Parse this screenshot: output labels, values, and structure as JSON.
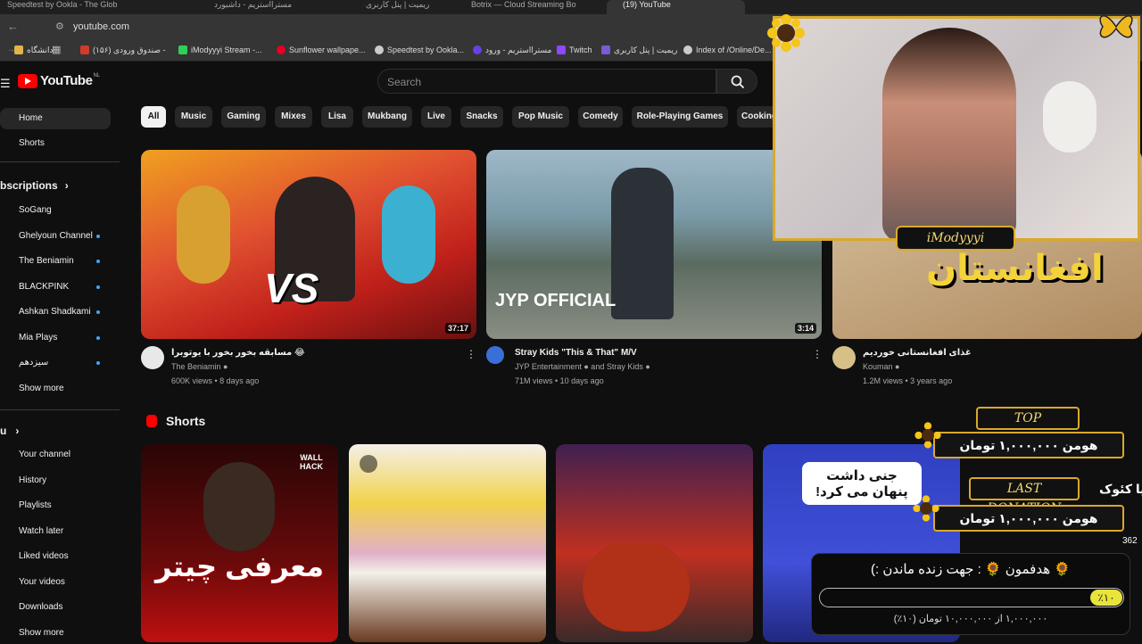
{
  "browser": {
    "tabs": [
      "Speedtest by Ookla - The Glob",
      "مسترااستریم - داشبورد",
      "ریمیت | پنل کاربری",
      "Botrix — Cloud Streaming Bot",
      "(19) YouTube"
    ],
    "url": "youtube.com",
    "bookmarks": [
      {
        "label": "دانشگاه",
        "color": "#e2b44a"
      },
      {
        "label": "صندوق ورودی (۱۵۶) -",
        "color": "#d23b2a"
      },
      {
        "label": "iModyyyi Stream -...",
        "color": "#2fcf57"
      },
      {
        "label": "Sunflower wallpape...",
        "color": "#e60023"
      },
      {
        "label": "Speedtest by Ookla...",
        "color": "#cccccc"
      },
      {
        "label": "مسترااستریم - ورود",
        "color": "#6b3ee6"
      },
      {
        "label": "Twitch",
        "color": "#9146ff"
      },
      {
        "label": "ریمیت | پنل کاربری",
        "color": "#7a5bd6"
      },
      {
        "label": "Index of /Online/De...",
        "color": "#cccccc"
      }
    ]
  },
  "youtube": {
    "logo_text": "YouTube",
    "region": "NL",
    "search_placeholder": "Search",
    "nav": [
      {
        "label": "Home"
      },
      {
        "label": "Shorts"
      }
    ],
    "subscriptions_heading": "bscriptions",
    "subscriptions": [
      {
        "label": "SoGang",
        "dot": false
      },
      {
        "label": "Ghelyoun Channel",
        "dot": true
      },
      {
        "label": "The Beniamin",
        "dot": true
      },
      {
        "label": "BLACKPINK",
        "dot": true
      },
      {
        "label": "Ashkan Shadkami",
        "dot": true
      },
      {
        "label": "Mia Plays",
        "dot": true
      },
      {
        "label": "سیزدهم",
        "dot": true
      },
      {
        "label": "Show more",
        "dot": false
      }
    ],
    "you_heading": "u",
    "you": [
      {
        "label": "Your channel"
      },
      {
        "label": "History"
      },
      {
        "label": "Playlists"
      },
      {
        "label": "Watch later"
      },
      {
        "label": "Liked videos"
      },
      {
        "label": "Your videos"
      },
      {
        "label": "Downloads"
      },
      {
        "label": "Show more"
      }
    ],
    "chips": [
      "All",
      "Music",
      "Gaming",
      "Mixes",
      "Lisa",
      "Mukbang",
      "Live",
      "Snacks",
      "Pop Music",
      "Comedy",
      "Role-Playing Games",
      "Cooking"
    ],
    "videos": [
      {
        "title": "مسابقه بخور بخور با یوتوبرا 😂",
        "channel": "The Beniamin",
        "meta": "600K views • 8 days ago",
        "duration": "37:17",
        "thumb_text": "VS"
      },
      {
        "title": "Stray Kids \"This & That\" M/V",
        "channel": "JYP Entertainment ● and Stray Kids",
        "meta": "71M views • 10 days ago",
        "duration": "3:14",
        "thumb_text": "JYP OFFICIAL"
      },
      {
        "title": "غذای افغانستانی خوردیم",
        "channel": "Kouman",
        "meta": "1.2M views • 3 years ago",
        "duration": "",
        "thumb_text": "افغانستان"
      }
    ],
    "shorts_heading": "Shorts",
    "shorts": [
      {
        "overlay": "معرفی چیتر",
        "corner": "WALL HACK"
      },
      {
        "overlay": ""
      },
      {
        "overlay": ""
      },
      {
        "overlay": "جنی داشت پنهان می کرد!"
      }
    ]
  },
  "stream_overlay": {
    "streamer_name": "iModyyyi",
    "top_donation_label": "TOP DONATION",
    "top_donation_value": "هومن ۱,۰۰۰,۰۰۰ تومان",
    "last_donation_label": "LAST DONATION",
    "last_donation_value": "هومن ۱,۰۰۰,۰۰۰ تومان",
    "side_text": "یا کئوک",
    "side_number": "362",
    "goal_title": "🌻 هدفمون 🌻 : جهت زنده ماندن :)",
    "goal_percent_label": "٪۱۰",
    "goal_progress": 0.1,
    "goal_detail": "۱,۰۰۰,۰۰۰ از ۱۰,۰۰۰,۰۰۰ تومان (۱۰٪)"
  }
}
